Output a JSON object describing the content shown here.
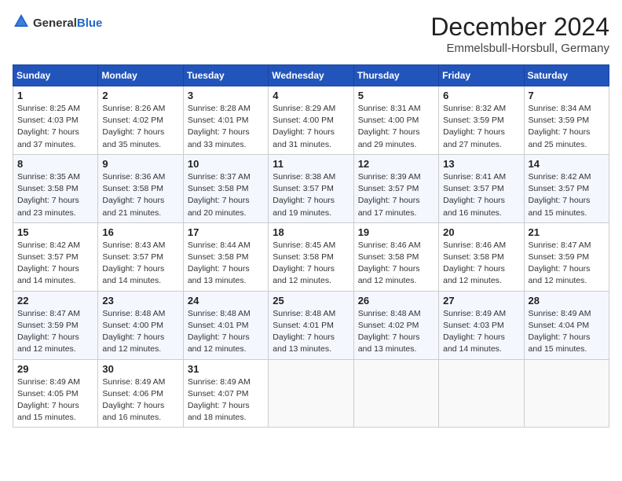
{
  "header": {
    "logo_general": "General",
    "logo_blue": "Blue",
    "title": "December 2024",
    "subtitle": "Emmelsbull-Horsbull, Germany"
  },
  "columns": [
    "Sunday",
    "Monday",
    "Tuesday",
    "Wednesday",
    "Thursday",
    "Friday",
    "Saturday"
  ],
  "weeks": [
    [
      {
        "day": "1",
        "sunrise": "8:25 AM",
        "sunset": "4:03 PM",
        "daylight": "7 hours and 37 minutes."
      },
      {
        "day": "2",
        "sunrise": "8:26 AM",
        "sunset": "4:02 PM",
        "daylight": "7 hours and 35 minutes."
      },
      {
        "day": "3",
        "sunrise": "8:28 AM",
        "sunset": "4:01 PM",
        "daylight": "7 hours and 33 minutes."
      },
      {
        "day": "4",
        "sunrise": "8:29 AM",
        "sunset": "4:00 PM",
        "daylight": "7 hours and 31 minutes."
      },
      {
        "day": "5",
        "sunrise": "8:31 AM",
        "sunset": "4:00 PM",
        "daylight": "7 hours and 29 minutes."
      },
      {
        "day": "6",
        "sunrise": "8:32 AM",
        "sunset": "3:59 PM",
        "daylight": "7 hours and 27 minutes."
      },
      {
        "day": "7",
        "sunrise": "8:34 AM",
        "sunset": "3:59 PM",
        "daylight": "7 hours and 25 minutes."
      }
    ],
    [
      {
        "day": "8",
        "sunrise": "8:35 AM",
        "sunset": "3:58 PM",
        "daylight": "7 hours and 23 minutes."
      },
      {
        "day": "9",
        "sunrise": "8:36 AM",
        "sunset": "3:58 PM",
        "daylight": "7 hours and 21 minutes."
      },
      {
        "day": "10",
        "sunrise": "8:37 AM",
        "sunset": "3:58 PM",
        "daylight": "7 hours and 20 minutes."
      },
      {
        "day": "11",
        "sunrise": "8:38 AM",
        "sunset": "3:57 PM",
        "daylight": "7 hours and 19 minutes."
      },
      {
        "day": "12",
        "sunrise": "8:39 AM",
        "sunset": "3:57 PM",
        "daylight": "7 hours and 17 minutes."
      },
      {
        "day": "13",
        "sunrise": "8:41 AM",
        "sunset": "3:57 PM",
        "daylight": "7 hours and 16 minutes."
      },
      {
        "day": "14",
        "sunrise": "8:42 AM",
        "sunset": "3:57 PM",
        "daylight": "7 hours and 15 minutes."
      }
    ],
    [
      {
        "day": "15",
        "sunrise": "8:42 AM",
        "sunset": "3:57 PM",
        "daylight": "7 hours and 14 minutes."
      },
      {
        "day": "16",
        "sunrise": "8:43 AM",
        "sunset": "3:57 PM",
        "daylight": "7 hours and 14 minutes."
      },
      {
        "day": "17",
        "sunrise": "8:44 AM",
        "sunset": "3:58 PM",
        "daylight": "7 hours and 13 minutes."
      },
      {
        "day": "18",
        "sunrise": "8:45 AM",
        "sunset": "3:58 PM",
        "daylight": "7 hours and 12 minutes."
      },
      {
        "day": "19",
        "sunrise": "8:46 AM",
        "sunset": "3:58 PM",
        "daylight": "7 hours and 12 minutes."
      },
      {
        "day": "20",
        "sunrise": "8:46 AM",
        "sunset": "3:58 PM",
        "daylight": "7 hours and 12 minutes."
      },
      {
        "day": "21",
        "sunrise": "8:47 AM",
        "sunset": "3:59 PM",
        "daylight": "7 hours and 12 minutes."
      }
    ],
    [
      {
        "day": "22",
        "sunrise": "8:47 AM",
        "sunset": "3:59 PM",
        "daylight": "7 hours and 12 minutes."
      },
      {
        "day": "23",
        "sunrise": "8:48 AM",
        "sunset": "4:00 PM",
        "daylight": "7 hours and 12 minutes."
      },
      {
        "day": "24",
        "sunrise": "8:48 AM",
        "sunset": "4:01 PM",
        "daylight": "7 hours and 12 minutes."
      },
      {
        "day": "25",
        "sunrise": "8:48 AM",
        "sunset": "4:01 PM",
        "daylight": "7 hours and 13 minutes."
      },
      {
        "day": "26",
        "sunrise": "8:48 AM",
        "sunset": "4:02 PM",
        "daylight": "7 hours and 13 minutes."
      },
      {
        "day": "27",
        "sunrise": "8:49 AM",
        "sunset": "4:03 PM",
        "daylight": "7 hours and 14 minutes."
      },
      {
        "day": "28",
        "sunrise": "8:49 AM",
        "sunset": "4:04 PM",
        "daylight": "7 hours and 15 minutes."
      }
    ],
    [
      {
        "day": "29",
        "sunrise": "8:49 AM",
        "sunset": "4:05 PM",
        "daylight": "7 hours and 15 minutes."
      },
      {
        "day": "30",
        "sunrise": "8:49 AM",
        "sunset": "4:06 PM",
        "daylight": "7 hours and 16 minutes."
      },
      {
        "day": "31",
        "sunrise": "8:49 AM",
        "sunset": "4:07 PM",
        "daylight": "7 hours and 18 minutes."
      },
      null,
      null,
      null,
      null
    ]
  ]
}
